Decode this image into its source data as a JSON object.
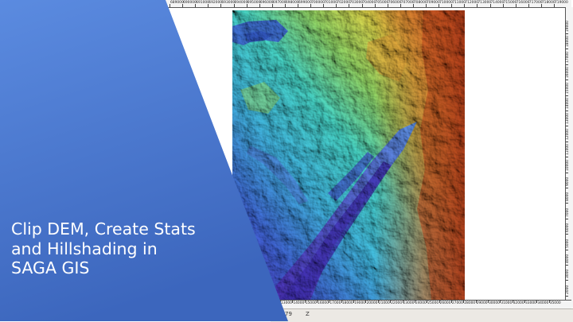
{
  "title": {
    "lines": [
      "Clip DEM, Create Stats",
      "and Hillshading in",
      "SAGA GIS"
    ]
  },
  "map": {
    "type": "DEM hillshade",
    "top_ruler_labels": [
      "689000",
      "690000",
      "691000",
      "692000",
      "693000",
      "694000",
      "695000",
      "696000",
      "697000",
      "698000",
      "699000",
      "700000",
      "701000",
      "702000",
      "703000",
      "704000",
      "705000",
      "706000",
      "707000",
      "708000",
      "709000",
      "710000",
      "711000",
      "712000",
      "713000",
      "714000",
      "715000",
      "716000",
      "717000",
      "718000",
      "719000",
      "720000"
    ],
    "right_ruler_labels": [
      "19000",
      "18000",
      "17000",
      "16000",
      "15000",
      "14000",
      "13000",
      "12000",
      "11000",
      "10000",
      "9000",
      "8000",
      "7000",
      "6000",
      "5000",
      "4000",
      "3000",
      "2000"
    ],
    "bottom_ruler_labels": [
      "13000",
      "14000",
      "15000",
      "16000",
      "17000",
      "18000",
      "19000",
      "20000",
      "21000",
      "22000",
      "23000",
      "24000",
      "25000",
      "26000",
      "27000",
      "28000",
      "29000",
      "30000",
      "31000",
      "32000",
      "33000",
      "34000",
      "35000"
    ],
    "status_left": "79",
    "status_right": "Z",
    "colors": {
      "banner": "#4472c4",
      "banner_light": "#5585d6",
      "low_elevation": "#5a44c8",
      "mid_elevation": "#45c9d9",
      "high_elevation": "#b13a1a",
      "title_text": "#ffffff"
    }
  }
}
